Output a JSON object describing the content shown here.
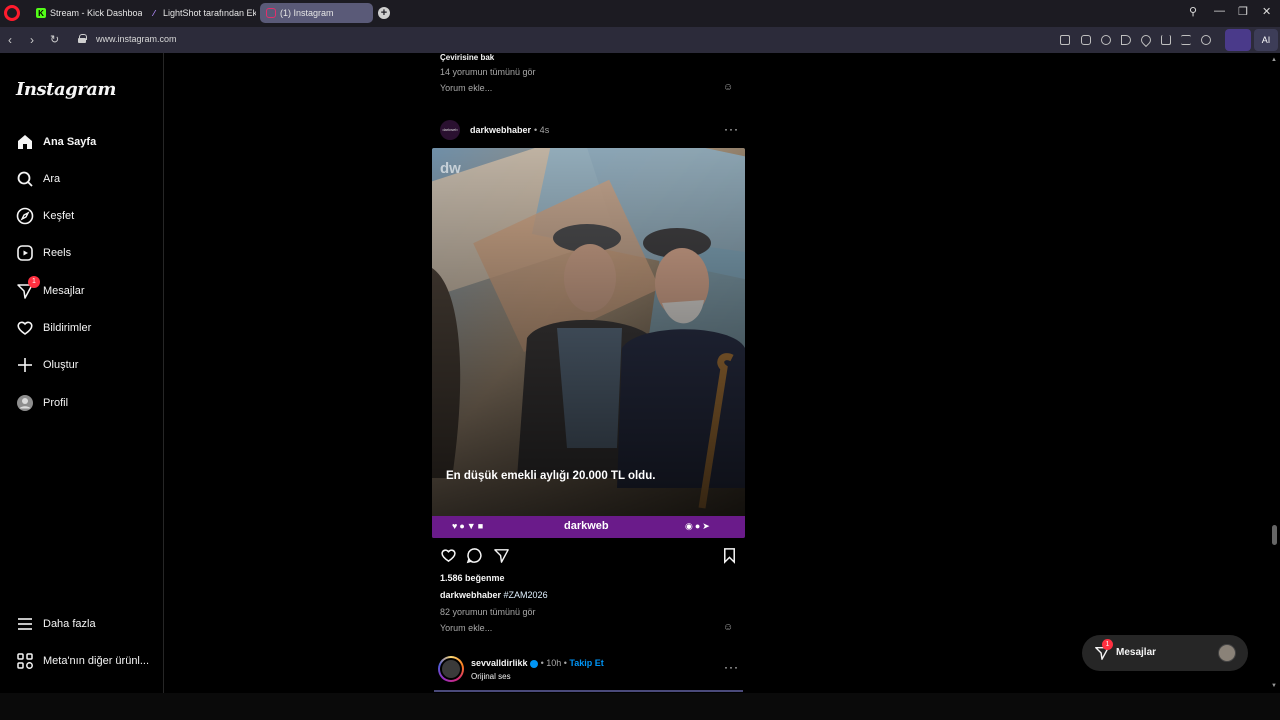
{
  "browser": {
    "tabs": [
      {
        "label": "Stream - Kick Dashboard",
        "icon": "kick-icon",
        "color": "#53fc18"
      },
      {
        "label": "LightShot tarafından Ekran",
        "icon": "lightshot-icon",
        "color": "#b48cff"
      },
      {
        "label": "(1) Instagram",
        "icon": "instagram-icon",
        "color": "#e1306c"
      }
    ],
    "url": "www.instagram.com",
    "ai_label": "AI"
  },
  "sidebar": {
    "logo": "Instagram",
    "items": [
      {
        "label": "Ana Sayfa",
        "icon": "home-icon"
      },
      {
        "label": "Ara",
        "icon": "search-icon"
      },
      {
        "label": "Keşfet",
        "icon": "compass-icon"
      },
      {
        "label": "Reels",
        "icon": "reels-icon"
      },
      {
        "label": "Mesajlar",
        "icon": "messenger-icon",
        "badge": "1"
      },
      {
        "label": "Bildirimler",
        "icon": "heart-icon"
      },
      {
        "label": "Oluştur",
        "icon": "plus-icon"
      },
      {
        "label": "Profil",
        "icon": "profile-icon"
      }
    ],
    "more_label": "Daha fazla",
    "meta_label": "Meta'nın diğer ürünl..."
  },
  "feed": {
    "prev_post": {
      "translate": "Çevirisine bak",
      "comments_link": "14 yorumun tümünü gör",
      "add_comment": "Yorum ekle..."
    },
    "post": {
      "username": "darkwebhaber",
      "time": "• 4s",
      "avatar_text": "darkweb",
      "image_watermark": "dw",
      "image_caption": "En düşük emekli aylığı 20.000 TL oldu.",
      "image_brand": "darkweb",
      "likes": "1.586 beğenme",
      "caption_user": "darkwebhaber",
      "caption_tag": "#ZAM2026",
      "comments_link": "82 yorumun tümünü gör",
      "add_comment": "Yorum ekle..."
    },
    "next_post": {
      "username": "sevvalldirlikk",
      "time": "• 10h •",
      "follow": "Takip Et",
      "audio": "Orijinal ses"
    }
  },
  "messages_float": {
    "label": "Mesajlar",
    "badge": "1"
  },
  "colors": {
    "accent": "#0095f6",
    "purple_band": "#6a1b8a",
    "badge": "#ff3040"
  }
}
